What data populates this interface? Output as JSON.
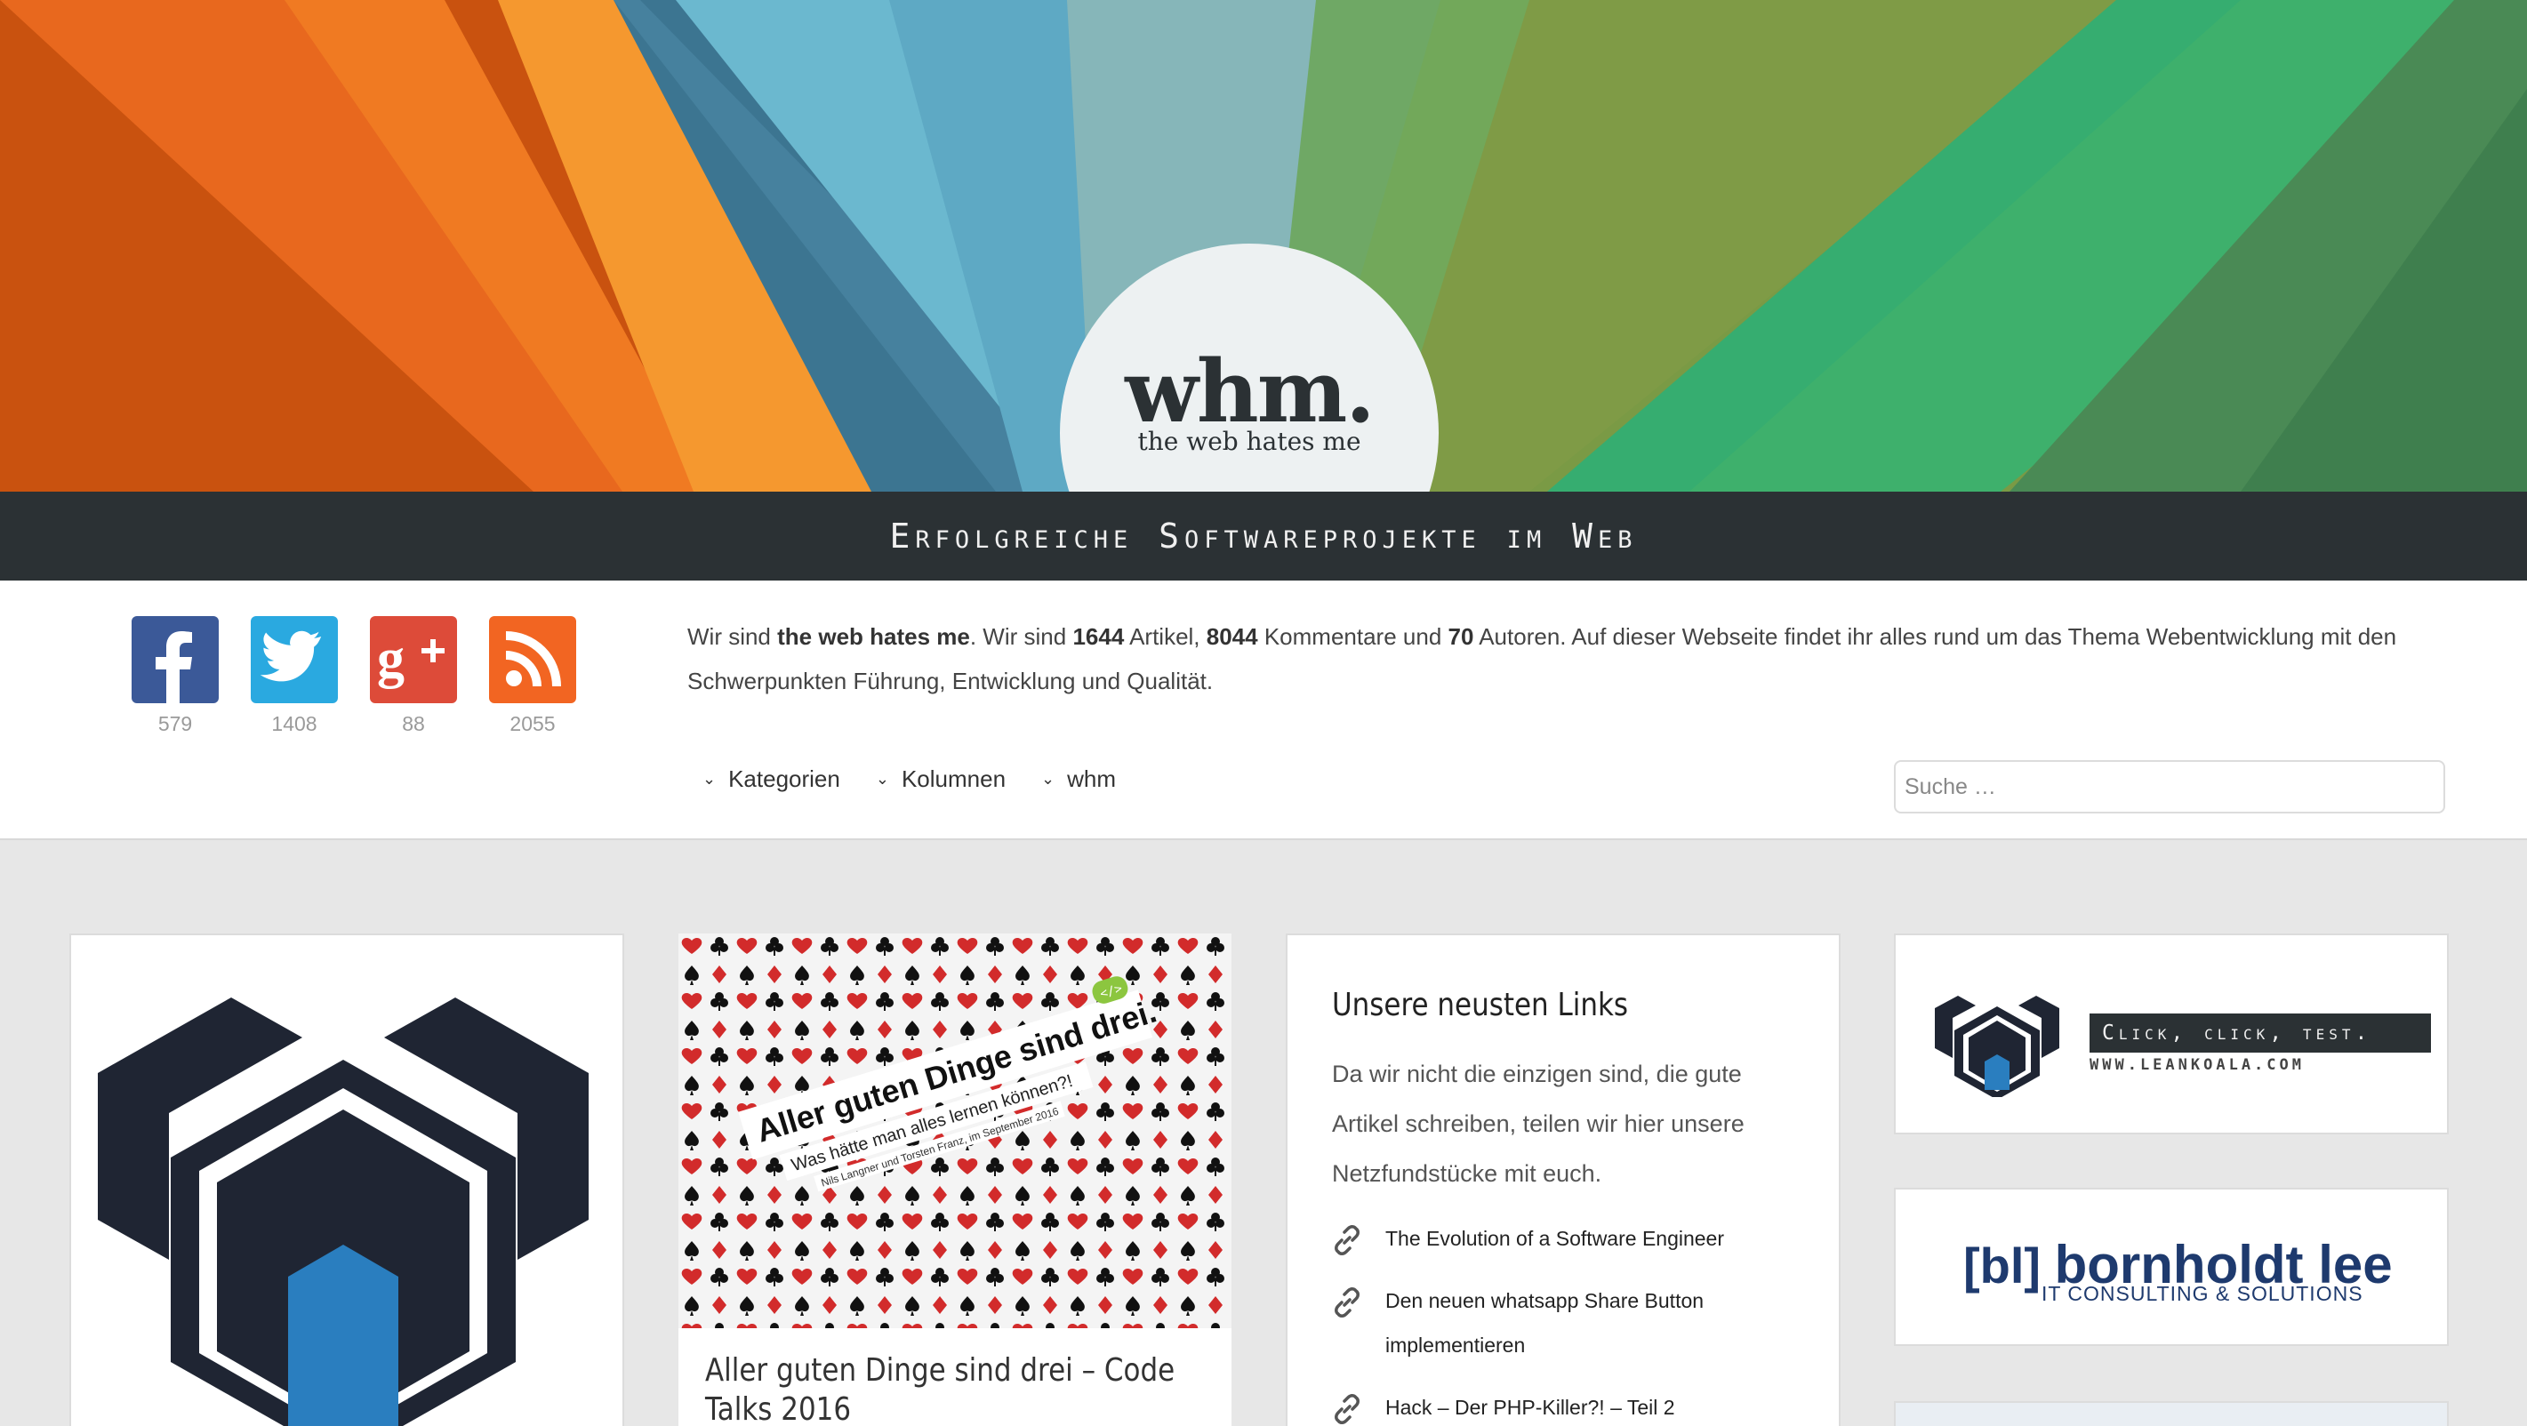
{
  "header": {
    "logo": "whm.",
    "logo_subtitle": "the web hates me",
    "tagline": "Erfolgreiche Softwareprojekte im Web"
  },
  "social": [
    {
      "name": "facebook",
      "count": "579",
      "color": "#3b5998"
    },
    {
      "name": "twitter",
      "count": "1408",
      "color": "#2aa9e0"
    },
    {
      "name": "google-plus",
      "count": "88",
      "color": "#dd4b39"
    },
    {
      "name": "rss",
      "count": "2055",
      "color": "#f26522"
    }
  ],
  "about": {
    "p1": "Wir sind ",
    "name": "the web hates me",
    "p2": ". Wir sind ",
    "articles": "1644",
    "p3": " Artikel, ",
    "comments": "8044",
    "p4": " Kommentare und ",
    "authors": "70",
    "p5": " Autoren. Auf dieser Webseite findet ihr alles rund um das Thema Webentwicklung mit den Schwerpunkten Führung, Entwicklung und Qualität."
  },
  "nav": {
    "items": [
      "Kategorien",
      "Kolumnen",
      "whm"
    ]
  },
  "search": {
    "placeholder": "Suche …"
  },
  "post": {
    "image_headline": "Aller guten Dinge sind drei.",
    "image_sub": "Was hätte man alles lernen können?!",
    "image_authors": "Nils Langner und Torsten Franz, im September 2016",
    "image_badge": "</>",
    "title": "Aller guten Dinge sind drei – Code Talks 2016"
  },
  "links_widget": {
    "heading": "Unsere neusten Links",
    "intro": "Da wir nicht die einzigen sind, die gute Artikel schreiben, teilen wir hier unsere Netzfundstücke mit euch.",
    "links": [
      "The Evolution of a Software Engineer",
      "Den neuen whatsapp Share Button implementieren",
      "Hack – Der PHP-Killer?! – Teil 2"
    ]
  },
  "ads": {
    "leankoala_slogan": "Click, click, test.",
    "leankoala_url": "WWW.LEANKOALA.COM",
    "bornholdt_mark": "[bl]",
    "bornholdt_name": "bornholdt lee",
    "bornholdt_sub": "IT CONSULTING & SOLUTIONS"
  }
}
